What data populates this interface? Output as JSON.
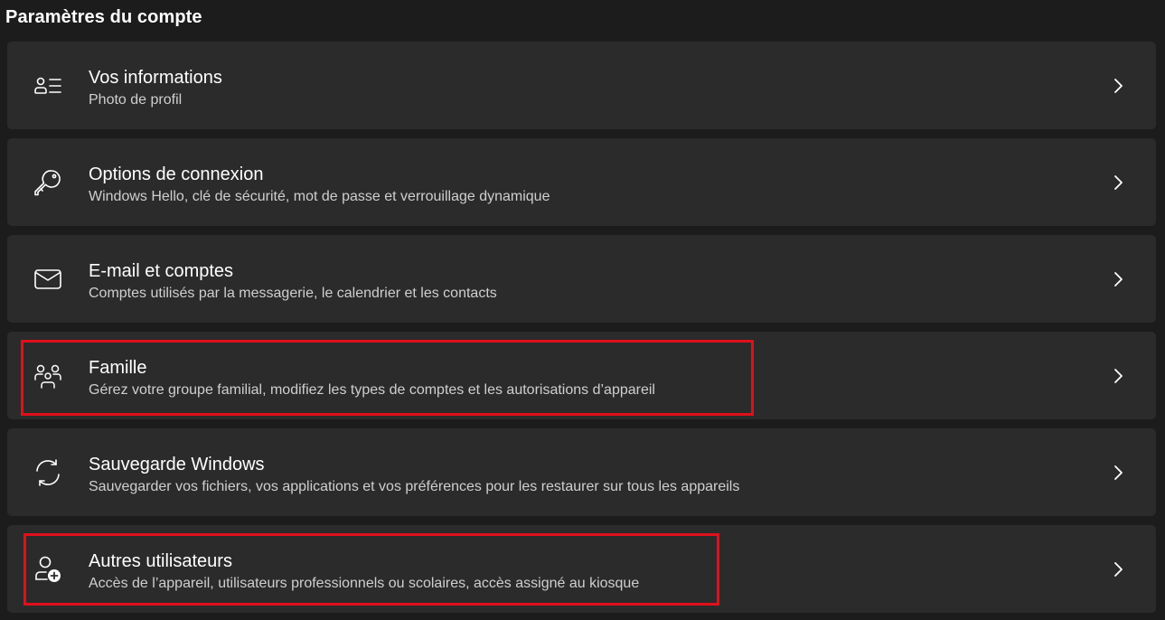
{
  "section": {
    "title": "Paramètres du compte"
  },
  "items": [
    {
      "title": "Vos informations",
      "description": "Photo de profil",
      "icon": "person-info-icon"
    },
    {
      "title": "Options de connexion",
      "description": "Windows Hello, clé de sécurité, mot de passe et verrouillage dynamique",
      "icon": "key-icon"
    },
    {
      "title": "E-mail et comptes",
      "description": "Comptes utilisés par la messagerie, le calendrier et les contacts",
      "icon": "mail-icon"
    },
    {
      "title": "Famille",
      "description": "Gérez votre groupe familial, modifiez les types de comptes et les autorisations d’appareil",
      "icon": "family-icon"
    },
    {
      "title": "Sauvegarde Windows",
      "description": "Sauvegarder vos fichiers, vos applications et vos préférences pour les restaurer sur tous les appareils",
      "icon": "sync-icon"
    },
    {
      "title": "Autres utilisateurs",
      "description": "Accès de l’appareil, utilisateurs professionnels ou scolaires, accès assigné au kiosque",
      "icon": "add-person-icon"
    }
  ],
  "colors": {
    "highlight": "#e0101c",
    "card": "#2b2b2b",
    "background": "#1c1c1c"
  }
}
